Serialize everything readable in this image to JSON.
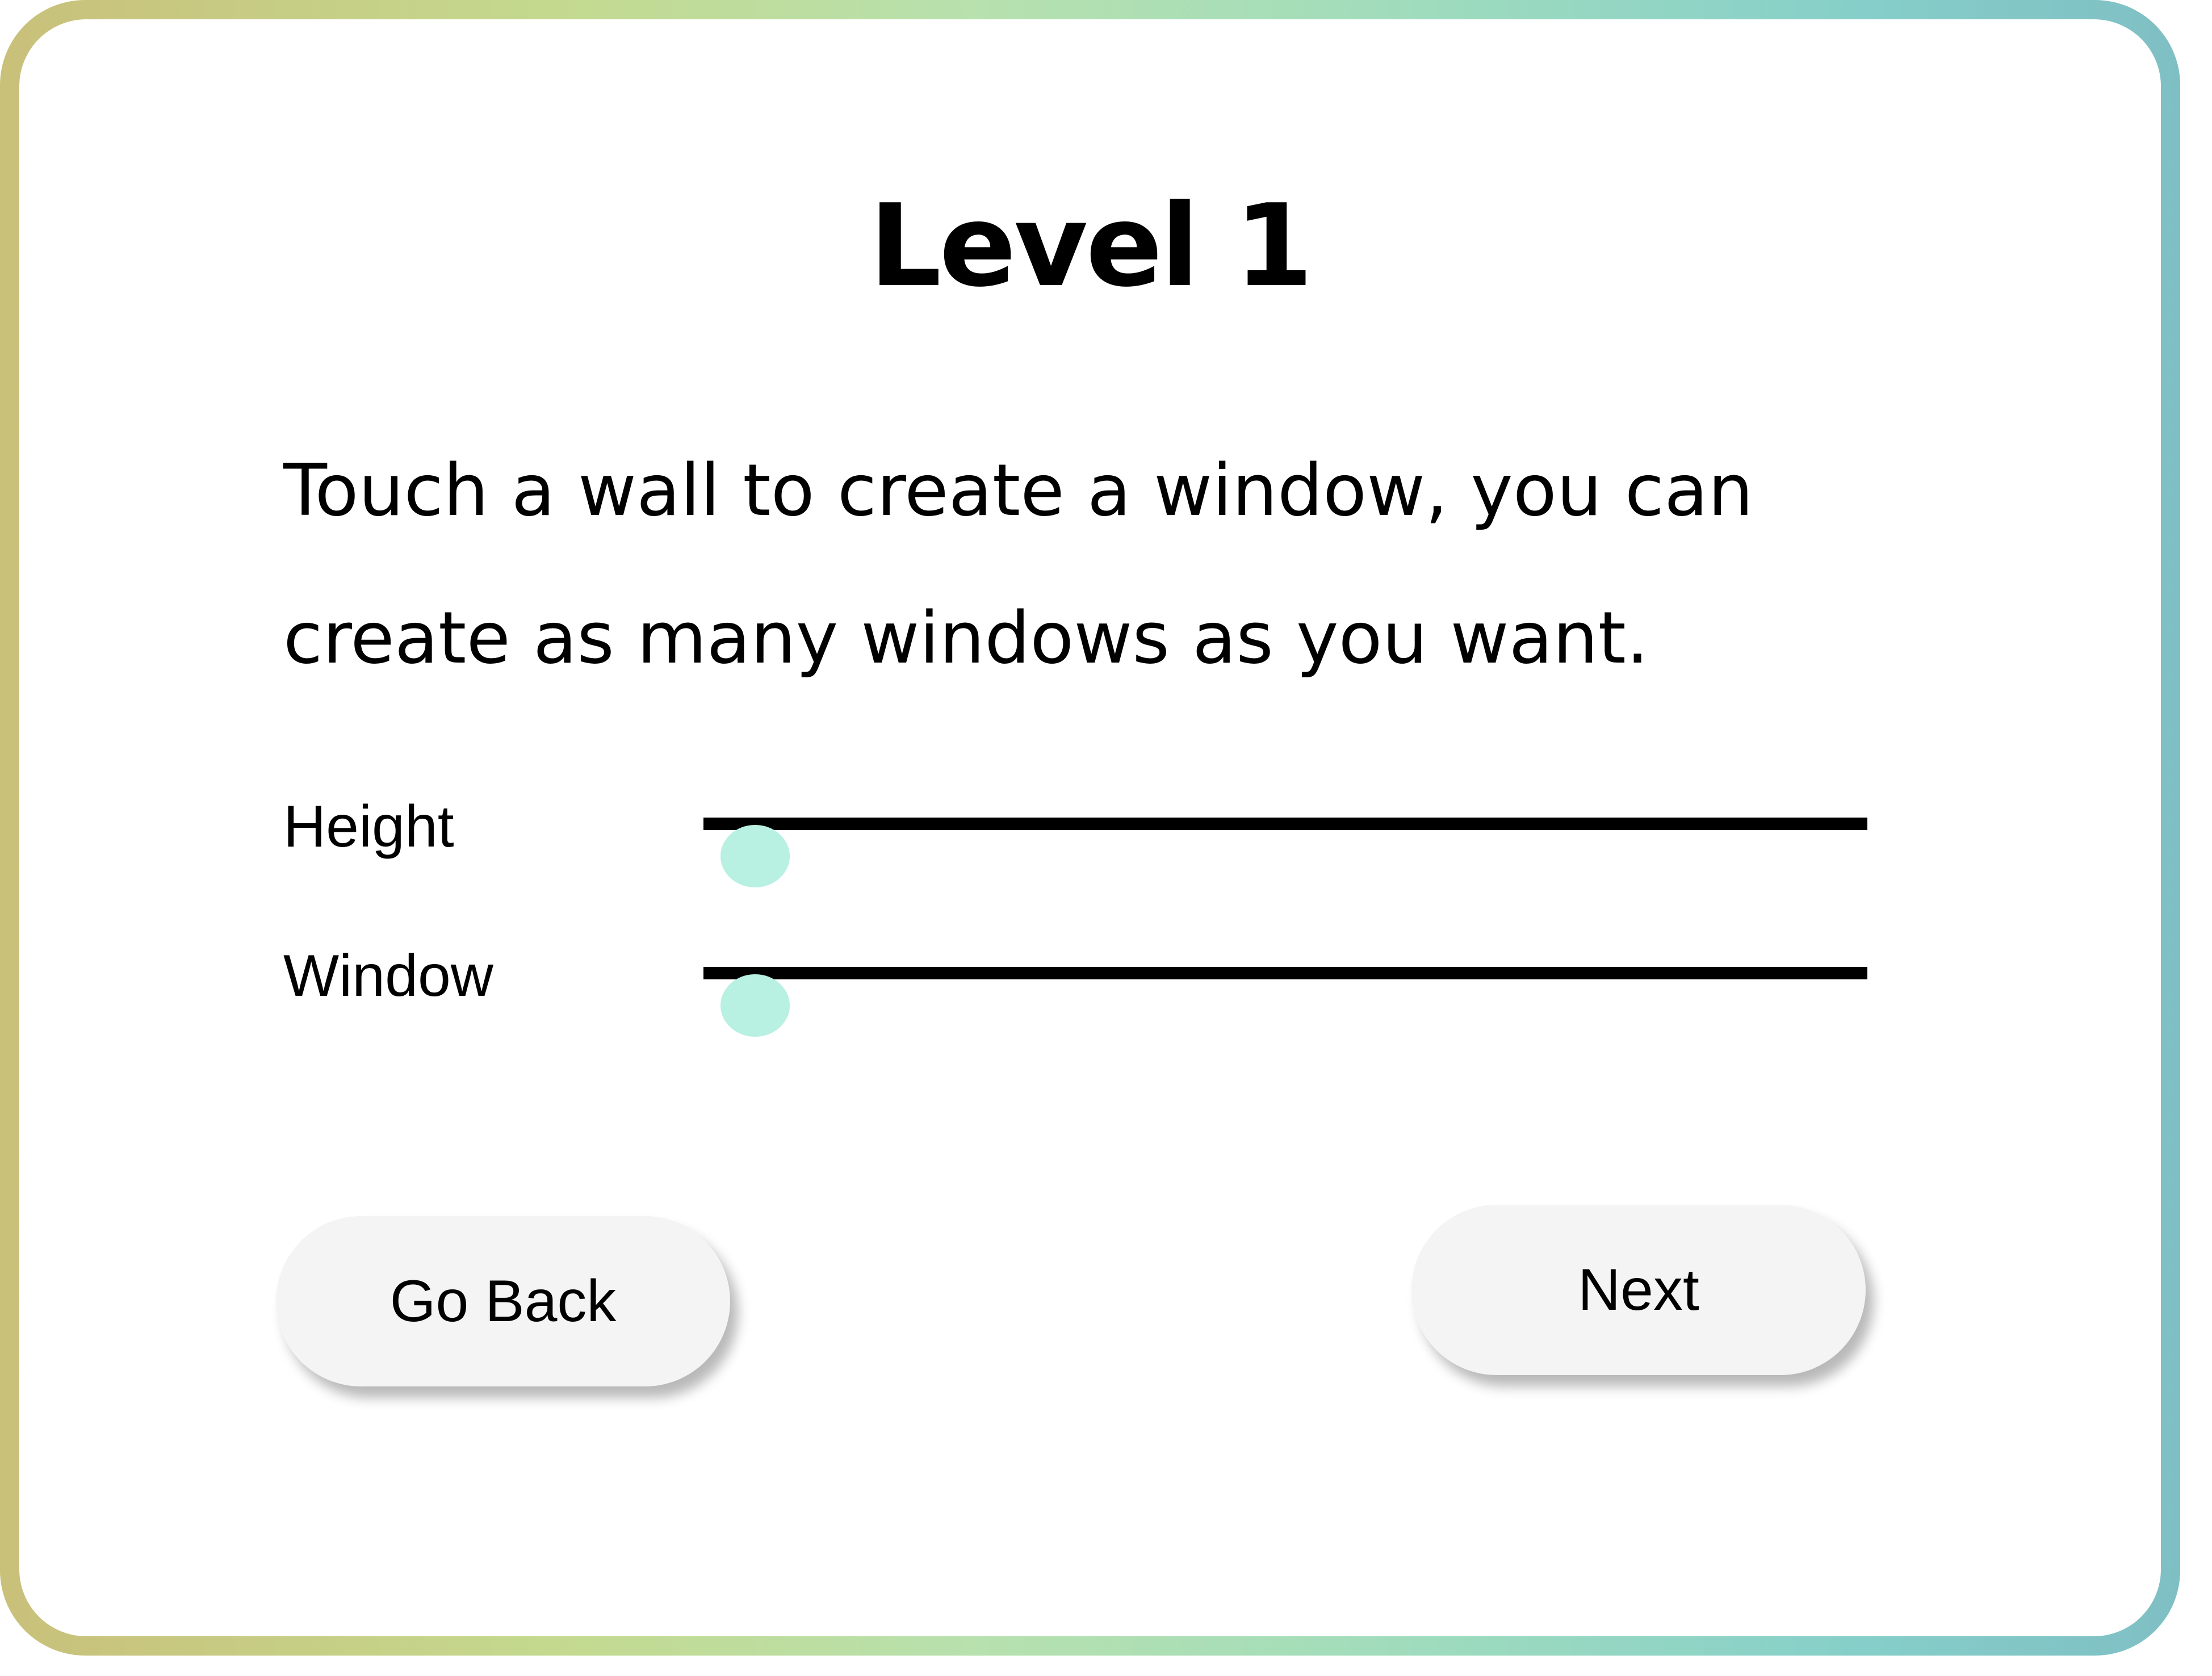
{
  "level_title": "Level 1",
  "instructions": "Touch a wall to create a window, you can create as many windows as you want.",
  "sliders": [
    {
      "label": "Height",
      "value": 0.0
    },
    {
      "label": "Window",
      "value": 0.0
    }
  ],
  "buttons": {
    "back_label": "Go Back",
    "next_label": "Next"
  },
  "colors": {
    "slider_thumb": "#b8f0e2",
    "slider_track": "#000000",
    "button_bg": "#f4f4f4",
    "border_gradient": [
      "#c9c07a",
      "#c4d98e",
      "#b7e1ae",
      "#9fdcbd",
      "#86cfc9",
      "#7fbfc4"
    ]
  }
}
